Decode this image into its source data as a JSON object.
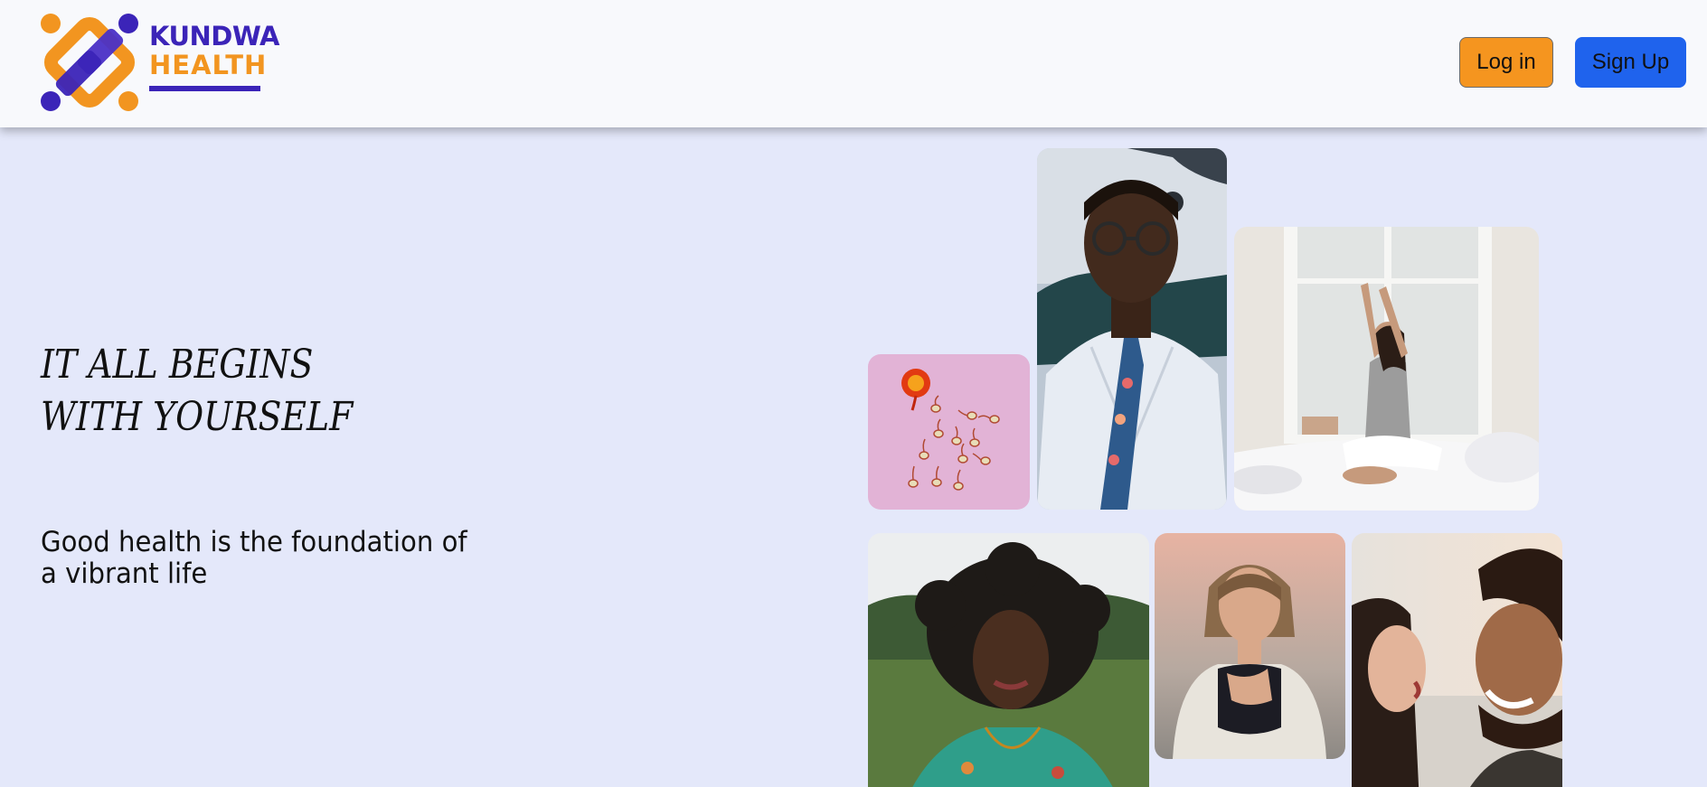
{
  "brand": {
    "name_line1": "KUNDWA",
    "name_line2": "HEALTH",
    "colors": {
      "purple": "#3b24b8",
      "orange": "#f29520"
    }
  },
  "header": {
    "login_label": "Log in",
    "signup_label": "Sign Up",
    "login_color": "#f5951f",
    "signup_color": "#1f63ed"
  },
  "hero": {
    "headline_line1": "IT ALL BEGINS",
    "headline_line2": "WITH YOURSELF",
    "subheadline": "Good health is the foundation of a vibrant life"
  },
  "gallery": {
    "images": [
      "fertility-photo",
      "doctor-photo",
      "woman-stretching-photo",
      "woman-curly-hair-photo",
      "woman-calm-photo",
      "couple-laughing-photo"
    ]
  },
  "page_background": "#e4e8fa"
}
